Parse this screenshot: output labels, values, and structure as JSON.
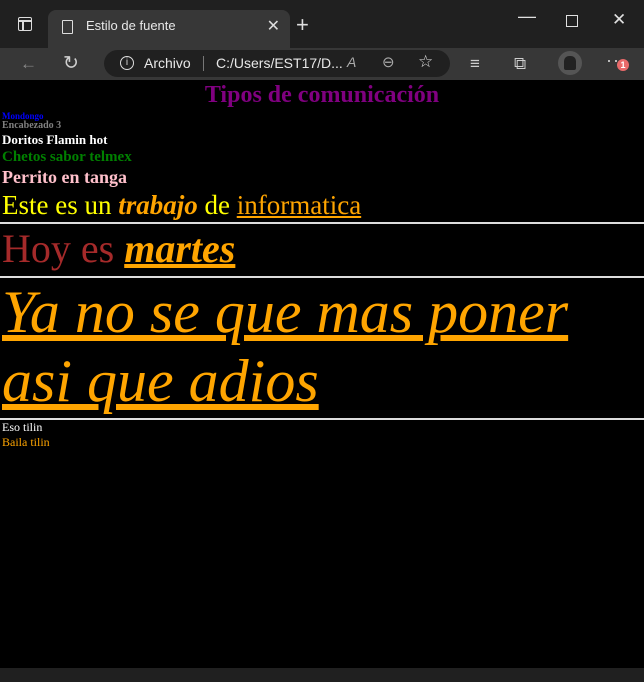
{
  "browser": {
    "tab_title": "Estilo de fuente",
    "new_tab_symbol": "+",
    "tab_close_symbol": "✕",
    "address_label": "Archivo",
    "address_url": "C:/Users/EST17/D...",
    "read_aloud_symbol": "A",
    "notification_count": "1",
    "minimize_symbol": "—",
    "close_symbol": "✕",
    "back_symbol": "←",
    "refresh_symbol": "↻",
    "zoom_symbol": "⊖",
    "favorite_symbol": "☆",
    "favorites_symbol": "≡",
    "collections_symbol": "⧉",
    "more_symbol": "···",
    "info_symbol": "i"
  },
  "page": {
    "heading1": "Tipos de comunicación",
    "heading6": "Mondongo",
    "heading5": "Encabezado 3",
    "heading4": "Doritos Flamin hot",
    "heading3": "Chetos sabor telmex",
    "heading2": "Perrito en tanga",
    "line1": {
      "pre": "Este es un ",
      "em": "trabajo",
      "mid": " de ",
      "link": "informatica"
    },
    "line2": {
      "pre": "Hoy es ",
      "em": "martes"
    },
    "line3": "Ya no se que mas poner asi que adios",
    "small1": "Eso tilin",
    "small2": "Baila tilin"
  },
  "colors": {
    "page_background": "#000000",
    "heading1": "#800080",
    "heading6": "#0000ff",
    "heading5": "#808080",
    "heading4": "#ffffff",
    "heading3": "#008000",
    "heading2": "#ffc0cb",
    "line1": "#ffff00",
    "accent": "#ffa500",
    "line2": "#a52a2a"
  }
}
